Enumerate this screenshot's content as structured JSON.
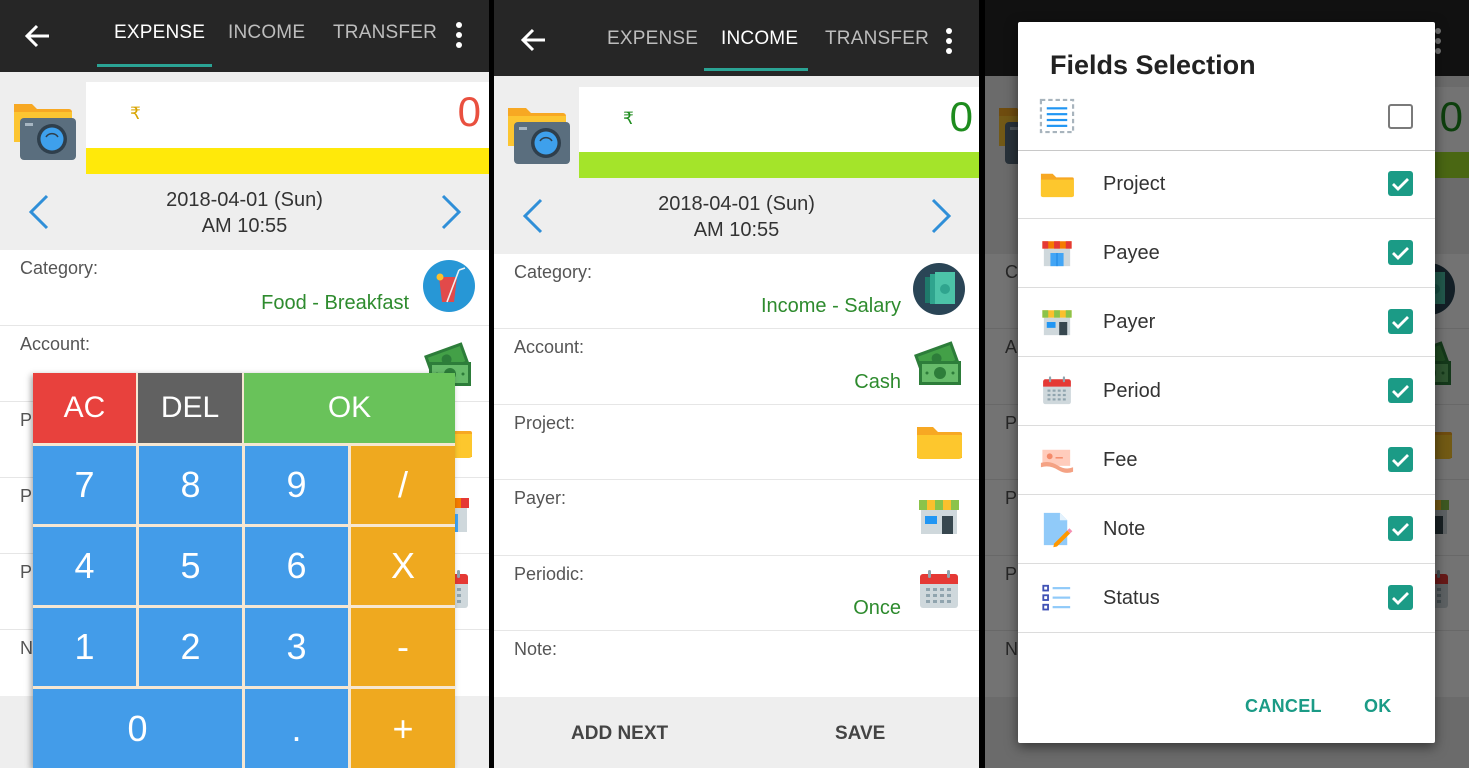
{
  "tabs": [
    "EXPENSE",
    "INCOME",
    "TRANSFER"
  ],
  "colors": {
    "tab_indicator": "#2aa394",
    "expense_amount": "#e9503f",
    "expense_bar": "#ffe90a",
    "income_amount": "#1e8c1e",
    "income_bar": "#a4e42a",
    "value_text": "#2e8b2e",
    "checkbox": "#1b9b86"
  },
  "expense_screen": {
    "active_tab": "EXPENSE",
    "currency_symbol": "₹",
    "amount": "0",
    "date": "2018-04-01 (Sun)",
    "time": "AM 10:55",
    "fields": [
      {
        "label": "Category:",
        "value": "Food - Breakfast",
        "icon": "drink-icon"
      },
      {
        "label": "Account:",
        "value": "",
        "icon": "cash-icon"
      },
      {
        "label": "P",
        "value": "",
        "icon": "folder-icon"
      },
      {
        "label": "P",
        "value": "",
        "icon": "shop-icon"
      },
      {
        "label": "P",
        "value": "",
        "icon": "calendar-icon"
      },
      {
        "label": "N",
        "value": "",
        "icon": ""
      }
    ],
    "keypad": {
      "ac": "AC",
      "del": "DEL",
      "ok": "OK",
      "rows": [
        [
          "7",
          "8",
          "9",
          "/"
        ],
        [
          "4",
          "5",
          "6",
          "X"
        ],
        [
          "1",
          "2",
          "3",
          "-"
        ]
      ],
      "zero": "0",
      "dot": ".",
      "plus": "+"
    }
  },
  "income_screen": {
    "active_tab": "INCOME",
    "currency_symbol": "₹",
    "amount": "0",
    "date": "2018-04-01 (Sun)",
    "time": "AM 10:55",
    "fields": [
      {
        "label": "Category:",
        "value": "Income - Salary",
        "icon": "salary-icon"
      },
      {
        "label": "Account:",
        "value": "Cash",
        "icon": "cash-icon"
      },
      {
        "label": "Project:",
        "value": "",
        "icon": "folder-icon"
      },
      {
        "label": "Payer:",
        "value": "",
        "icon": "shop-icon"
      },
      {
        "label": "Periodic:",
        "value": "Once",
        "icon": "calendar-icon"
      },
      {
        "label": "Note:",
        "value": "",
        "icon": ""
      }
    ],
    "add_next": "ADD NEXT",
    "save": "SAVE"
  },
  "fields_dialog": {
    "title": "Fields Selection",
    "select_all_checked": false,
    "items": [
      {
        "label": "Project",
        "icon": "folder-icon",
        "checked": true
      },
      {
        "label": "Payee",
        "icon": "payee-shop-icon",
        "checked": true
      },
      {
        "label": "Payer",
        "icon": "payer-shop-icon",
        "checked": true
      },
      {
        "label": "Period",
        "icon": "calendar-icon",
        "checked": true
      },
      {
        "label": "Fee",
        "icon": "fee-icon",
        "checked": true
      },
      {
        "label": "Note",
        "icon": "note-icon",
        "checked": true
      },
      {
        "label": "Status",
        "icon": "status-list-icon",
        "checked": true
      }
    ],
    "cancel": "CANCEL",
    "ok": "OK",
    "background_partial_labels": [
      "C",
      "A",
      "P",
      "P",
      "P",
      "N"
    ],
    "background_amount": "0"
  }
}
